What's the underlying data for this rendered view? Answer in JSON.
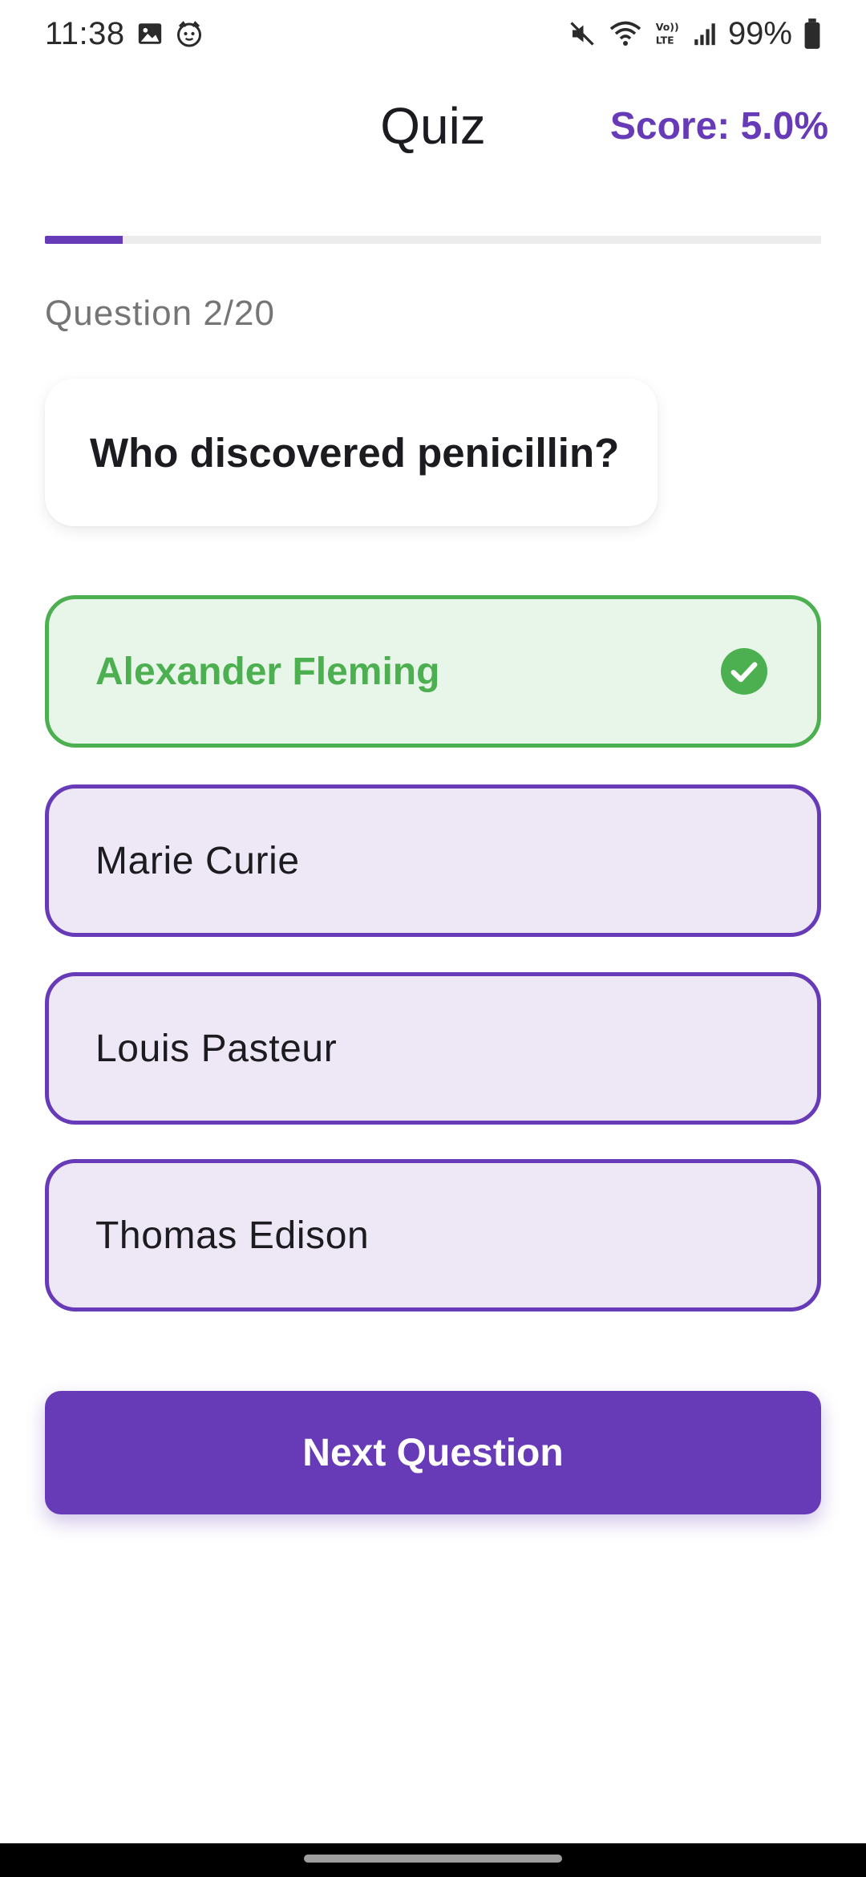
{
  "status_bar": {
    "time": "11:38",
    "battery_percent": "99%",
    "left_icons": [
      "image-icon",
      "cat-face-icon"
    ],
    "right_icons": [
      "mute-icon",
      "wifi-icon",
      "volte-icon",
      "signal-icon",
      "battery-icon"
    ],
    "lte_text": "Vo))\nLTE"
  },
  "app_bar": {
    "title": "Quiz",
    "score": "Score: 5.0%"
  },
  "progress": {
    "current": 2,
    "total": 20,
    "fill_fraction": 0.1,
    "label": "Question 2/20"
  },
  "question": {
    "text": "Who discovered penicillin?"
  },
  "answers": [
    {
      "label": "Alexander Fleming",
      "state": "correct",
      "icon": "check-circle-icon"
    },
    {
      "label": "Marie Curie",
      "state": "default"
    },
    {
      "label": "Louis Pasteur",
      "state": "default"
    },
    {
      "label": "Thomas Edison",
      "state": "default"
    }
  ],
  "next_button": {
    "label": "Next Question"
  },
  "colors": {
    "primary": "#673ab7",
    "correct": "#4caf50",
    "correct_bg": "#e8f5e9",
    "option_bg": "#ede7f6",
    "track": "#ececec"
  }
}
